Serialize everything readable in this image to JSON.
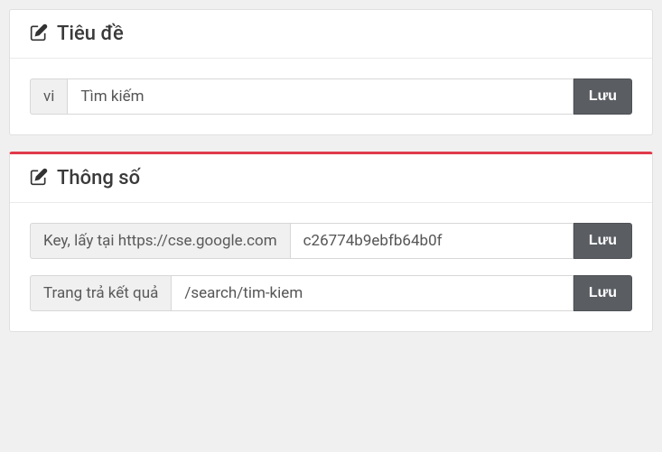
{
  "panels": {
    "title": {
      "heading": "Tiêu đề",
      "fields": {
        "vi": {
          "addon": "vi",
          "value": "Tìm kiếm",
          "button": "Lưu"
        }
      }
    },
    "params": {
      "heading": "Thông số",
      "fields": {
        "key": {
          "addon": "Key, lấy tại https://cse.google.com",
          "value": "c26774b9ebfb64b0f",
          "button": "Lưu"
        },
        "result_page": {
          "addon": "Trang trả kết quả",
          "value": "/search/tim-kiem",
          "button": "Lưu"
        }
      }
    }
  }
}
